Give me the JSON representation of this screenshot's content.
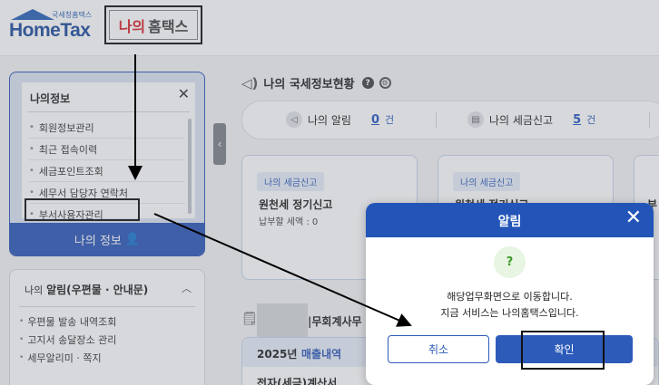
{
  "header": {
    "logo_sub": "국세청홈택스",
    "logo_main": "HomeTax",
    "myhome_part1": "나의",
    "myhome_part2": "홈택스"
  },
  "myinfo": {
    "title": "나의정보",
    "items": [
      {
        "label": "회원정보관리"
      },
      {
        "label": "최근 접속이력"
      },
      {
        "label": "세금포인트조회"
      },
      {
        "label": "세무서 담당자 연락처"
      },
      {
        "label": "부서사용자관리"
      }
    ],
    "footer_label": "나의 정보"
  },
  "alerts": {
    "title_prefix": "나의",
    "title_main": "알림(우편물 · 안내문)",
    "items": [
      {
        "label": "우편물 발송 내역조회"
      },
      {
        "label": "고지서 송달장소 관리"
      },
      {
        "label": "세무알리미 · 쪽지"
      }
    ]
  },
  "status": {
    "title": "나의 국세정보현황",
    "stats": [
      {
        "label": "나의 알림",
        "count": "0",
        "unit": "건"
      },
      {
        "label": "나의 세금신고",
        "count": "5",
        "unit": "건"
      }
    ]
  },
  "tax_cards": [
    {
      "tag": "나의 세금신고",
      "name": "원천세 정기신고",
      "amount": "납부할 세액 : 0"
    },
    {
      "tag": "나의 세금신고",
      "name": "원천세 정기신고",
      "amount": ""
    },
    {
      "tag": "",
      "name": "부",
      "amount": ""
    }
  ],
  "accounting": {
    "title_fragment": "|무회계사무",
    "year": "2025년",
    "kind": "매출내역",
    "item": "전자(세금)계산서"
  },
  "dialog": {
    "title": "알림",
    "badge": "?",
    "message_line1": "해당업무화면으로 이동합니다.",
    "message_line2": "지금 서비스는 나의홈택스입니다.",
    "cancel_label": "취소",
    "confirm_label": "확인"
  },
  "colors": {
    "primary": "#2255b7",
    "brand_red": "#d8262e",
    "success": "#3a9a28"
  }
}
